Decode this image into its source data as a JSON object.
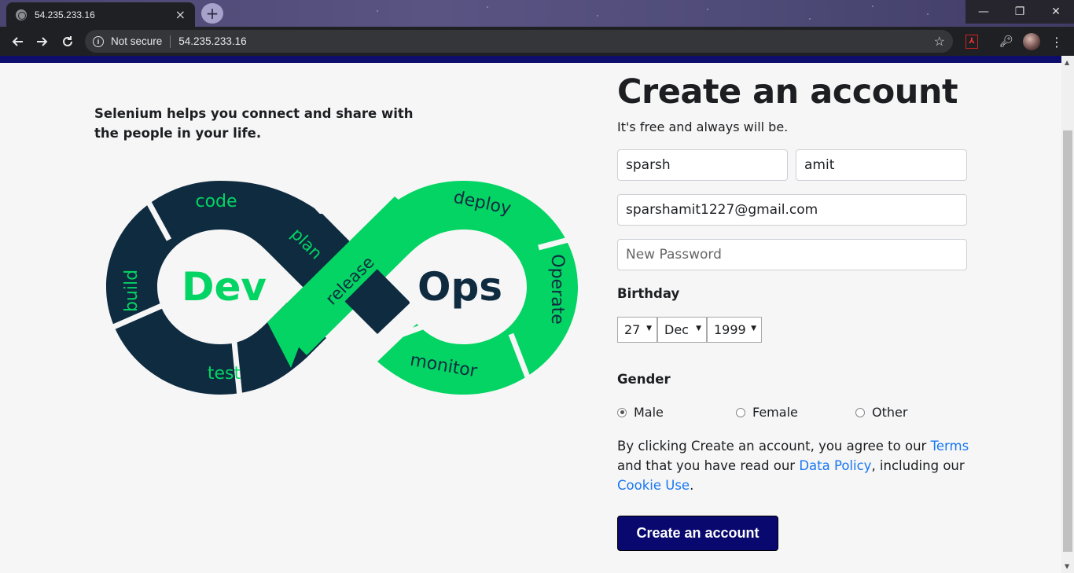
{
  "browser": {
    "tab_title": "54.235.233.16",
    "tab_close": "×",
    "new_tab": "+",
    "security_label": "Not secure",
    "url": "54.235.233.16",
    "window_min": "—",
    "window_max": "❐",
    "window_close": "✕"
  },
  "left": {
    "tagline": "Selenium helps you connect and share with the people in your life.",
    "diagram": {
      "dev_label": "Dev",
      "ops_label": "Ops",
      "stages": [
        "code",
        "build",
        "test",
        "plan",
        "release",
        "deploy",
        "Operate",
        "monitor"
      ],
      "colors": {
        "dark": "#0f2b40",
        "green": "#03d463"
      }
    }
  },
  "form": {
    "title": "Create an account",
    "subtitle": "It's free and always will be.",
    "first_name": "sparsh",
    "last_name": "amit",
    "email": "sparshamit1227@gmail.com",
    "password_placeholder": "New Password",
    "birthday_label": "Birthday",
    "birthday": {
      "day": "27",
      "month": "Dec",
      "year": "1999"
    },
    "gender_label": "Gender",
    "gender_options": [
      "Male",
      "Female",
      "Other"
    ],
    "gender_selected": "Male",
    "terms": {
      "part1": "By clicking Create an account, you agree to our ",
      "terms_link": "Terms",
      "part2": " and that you have read our ",
      "data_policy_link": "Data Policy",
      "part3": ", including our ",
      "cookie_link": "Cookie Use",
      "part4": "."
    },
    "submit_label": "Create an account"
  },
  "colors": {
    "accent_navy": "#08086e",
    "link_blue": "#1877f2"
  }
}
